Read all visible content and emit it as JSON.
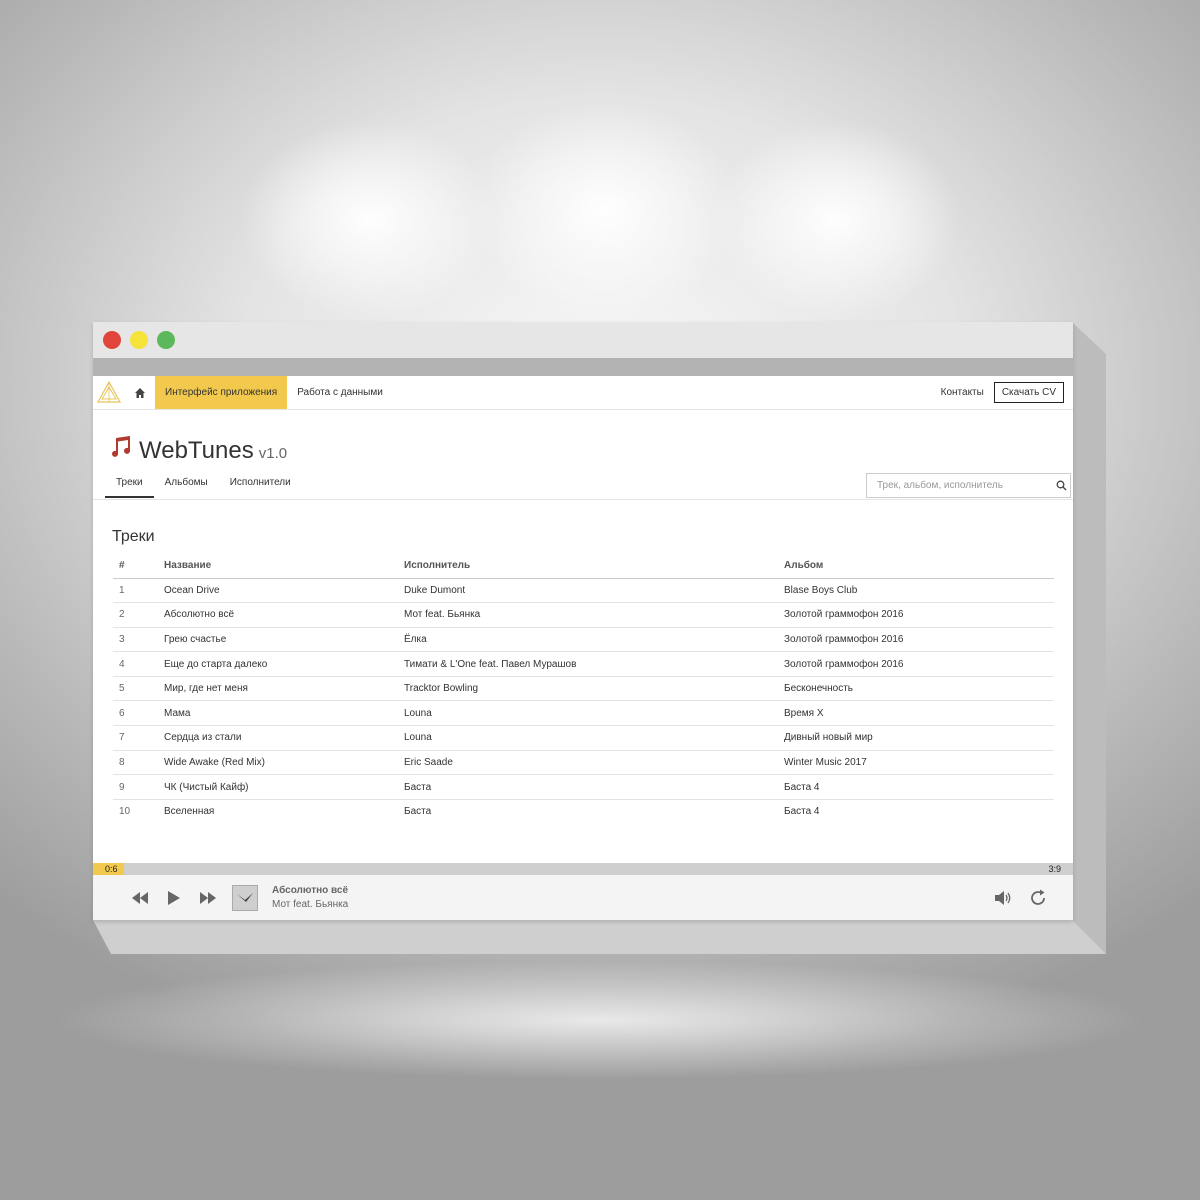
{
  "colors": {
    "accent": "#f2c94c",
    "brand_note": "#b23a2e",
    "close_dot": "#e0443a",
    "minimize_dot": "#f5e33a",
    "maximize_dot": "#5cb85c"
  },
  "navbar": {
    "nav_items": [
      "Интерфейс приложения",
      "Работа с данными"
    ],
    "contacts": "Контакты",
    "cv_button": "Скачать CV"
  },
  "app": {
    "brand": "WebTunes",
    "version": "v1.0"
  },
  "tabs": [
    "Треки",
    "Альбомы",
    "Исполнители"
  ],
  "search": {
    "placeholder": "Трек, альбом, исполнитель"
  },
  "tracks": {
    "title": "Треки",
    "columns": [
      "#",
      "Название",
      "Исполнитель",
      "Альбом"
    ],
    "rows": [
      [
        "1",
        "Ocean Drive",
        "Duke Dumont",
        "Blase Boys Club"
      ],
      [
        "2",
        "Абсолютно всё",
        "Мот feat. Бьянка",
        "Золотой граммофон 2016"
      ],
      [
        "3",
        "Грею счастье",
        "Ёлка",
        "Золотой граммофон 2016"
      ],
      [
        "4",
        "Еще до старта далеко",
        "Тимати & L'One feat. Павел Мурашов",
        "Золотой граммофон 2016"
      ],
      [
        "5",
        "Мир, где нет меня",
        "Tracktor Bowling",
        "Бесконечность"
      ],
      [
        "6",
        "Мама",
        "Louna",
        "Время X"
      ],
      [
        "7",
        "Сердца из стали",
        "Louna",
        "Дивный новый мир"
      ],
      [
        "8",
        "Wide Awake (Red Mix)",
        "Eric Saade",
        "Winter Music 2017"
      ],
      [
        "9",
        "ЧК (Чистый Кайф)",
        "Баста",
        "Баста 4"
      ],
      [
        "10",
        "Вселенная",
        "Баста",
        "Баста 4"
      ]
    ]
  },
  "player": {
    "elapsed": "0:6",
    "duration": "3:9",
    "progress_fraction": 0.032,
    "title": "Абсолютно всё",
    "artist": "Мот feat. Бьянка"
  }
}
